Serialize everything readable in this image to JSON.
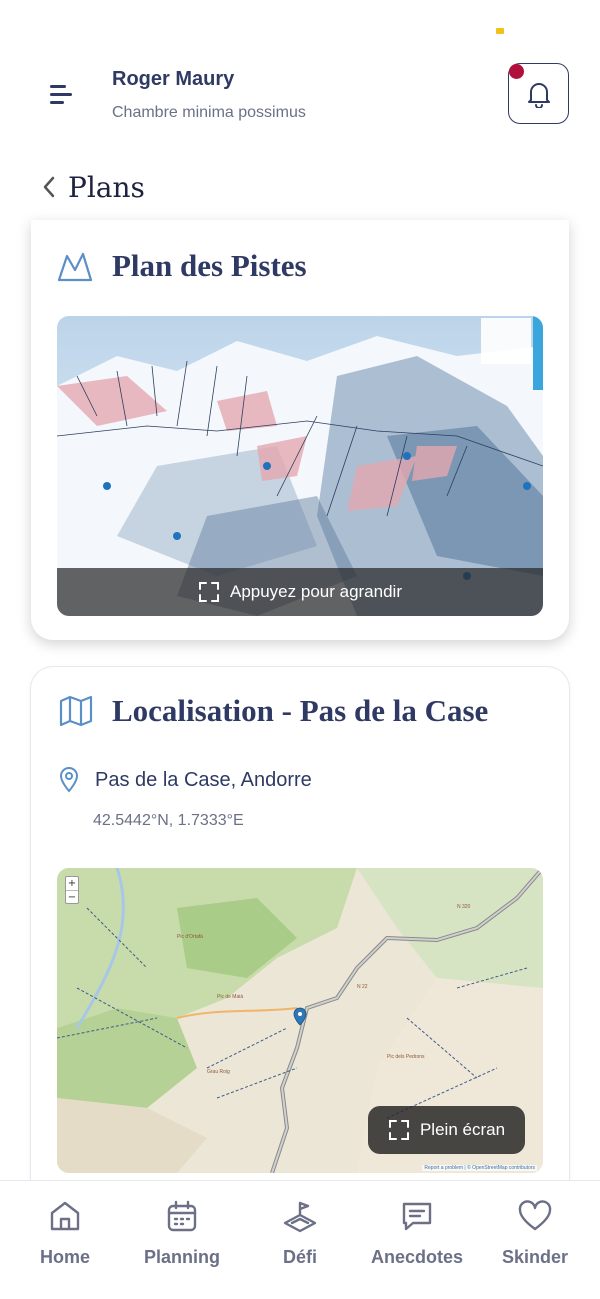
{
  "header": {
    "user_name": "Roger Maury",
    "user_subtitle": "Chambre minima possimus"
  },
  "page": {
    "back_title": "Plans"
  },
  "ski_plan": {
    "title": "Plan des Pistes",
    "expand_label": "Appuyez pour agrandir"
  },
  "location": {
    "title": "Localisation - Pas de la Case",
    "place": "Pas de la Case, Andorre",
    "coordinates": "42.5442°N, 1.7333°E",
    "fullscreen_label": "Plein écran",
    "zoom_in": "+",
    "zoom_out": "−",
    "attribution": "Report a problem | © OpenStreetMap contributors"
  },
  "nav": {
    "items": [
      {
        "label": "Home",
        "icon": "home-icon"
      },
      {
        "label": "Planning",
        "icon": "calendar-icon"
      },
      {
        "label": "Défi",
        "icon": "challenge-icon"
      },
      {
        "label": "Anecdotes",
        "icon": "chat-icon"
      },
      {
        "label": "Skinder",
        "icon": "heart-icon"
      }
    ]
  },
  "colors": {
    "primary": "#2e3a63",
    "muted": "#6b7087",
    "badge": "#b0103c",
    "icon_blue": "#5b8fc7"
  }
}
